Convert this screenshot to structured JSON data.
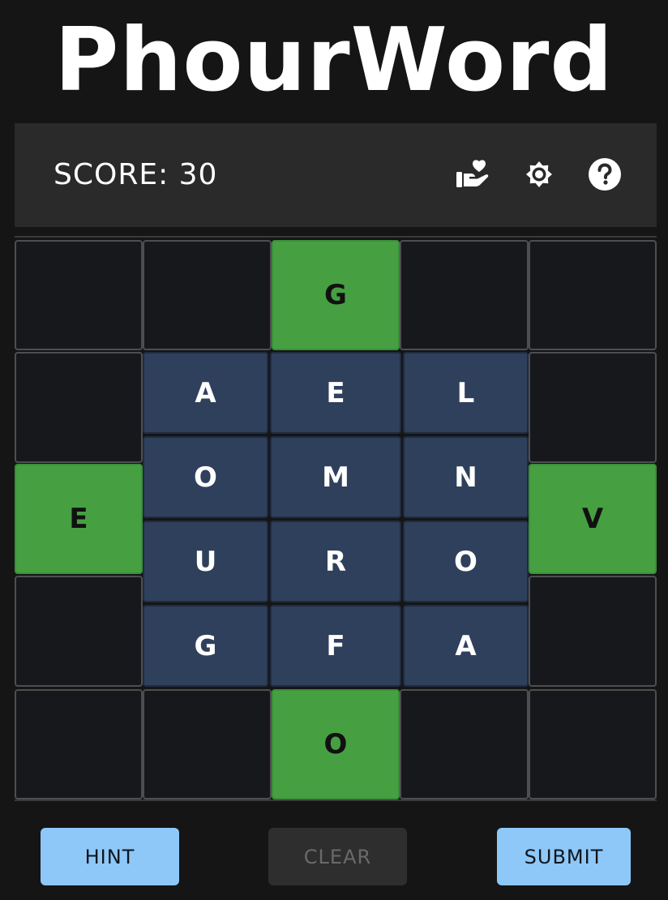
{
  "app": {
    "title": "PhourWord"
  },
  "header": {
    "score_text": "SCORE: 30",
    "icons": [
      "donate-heart-hand-icon",
      "settings-gear-icon",
      "help-question-icon"
    ]
  },
  "board": {
    "top_row": [
      "",
      "",
      "G",
      "",
      ""
    ],
    "bottom_row": [
      "",
      "",
      "O",
      "",
      ""
    ],
    "left_column": [
      "",
      "E",
      ""
    ],
    "right_column": [
      "",
      "V",
      ""
    ],
    "inner_grid": [
      [
        "A",
        "E",
        "L"
      ],
      [
        "O",
        "M",
        "N"
      ],
      [
        "U",
        "R",
        "O"
      ],
      [
        "G",
        "F",
        "A"
      ]
    ]
  },
  "buttons": {
    "hint": "HINT",
    "clear": "CLEAR",
    "submit": "SUBMIT"
  },
  "colors": {
    "background": "#151515",
    "bar": "#2a2a2a",
    "tile_found": "#46a042",
    "tile_inner": "#2f405c",
    "tile_empty": "#17181c",
    "button_primary": "#8ec8f8",
    "button_disabled": "#2e2e2e"
  }
}
